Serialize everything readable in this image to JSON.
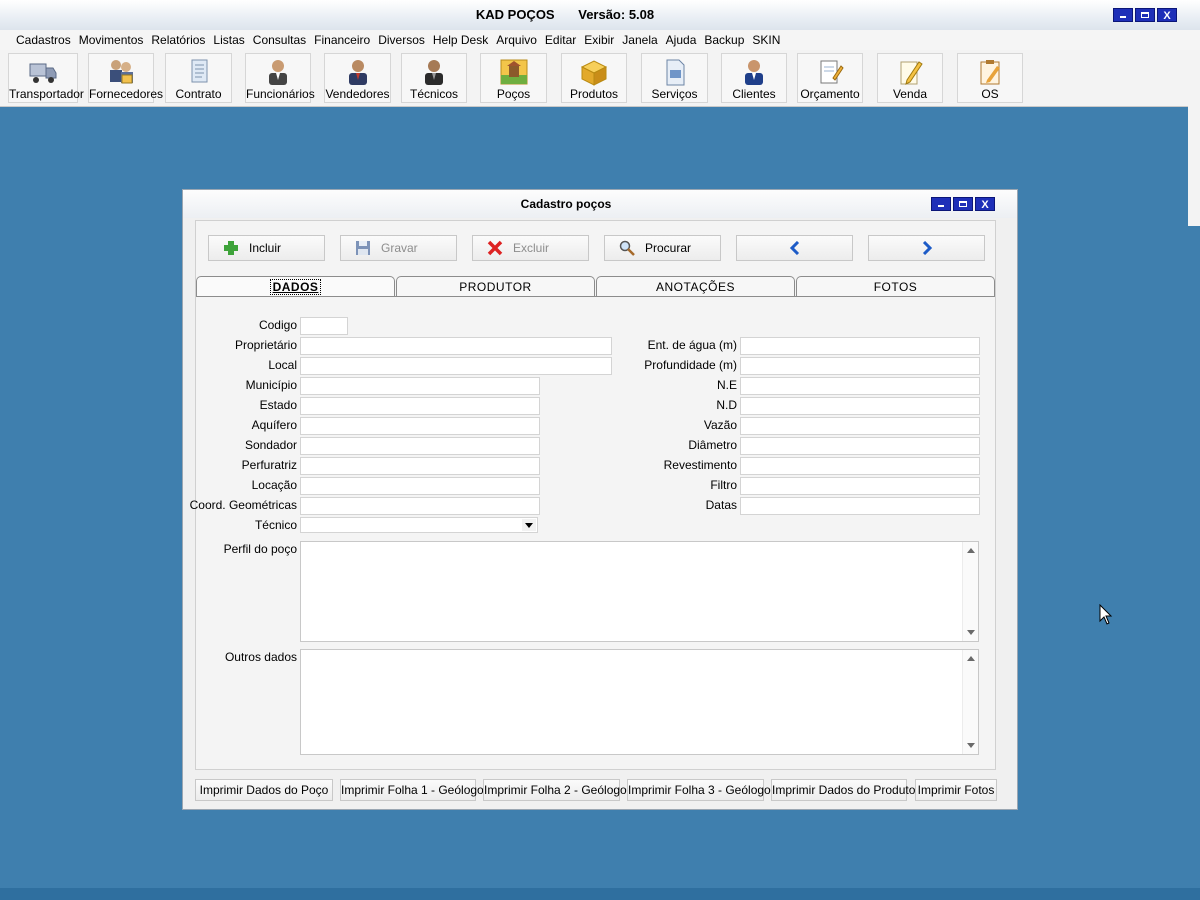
{
  "window": {
    "app_title": "KAD POÇOS",
    "version": "Versão: 5.08"
  },
  "menu": [
    "Cadastros",
    "Movimentos",
    "Relatórios",
    "Listas",
    "Consultas",
    "Financeiro",
    "Diversos",
    "Help Desk",
    "Arquivo",
    "Editar",
    "Exibir",
    "Janela",
    "Ajuda",
    "Backup",
    "SKIN"
  ],
  "toolbar": {
    "transportador": "Transportador",
    "fornecedores": "Fornecedores",
    "contrato": "Contrato",
    "funcionarios": "Funcionários",
    "vendedores": "Vendedores",
    "tecnicos": "Técnicos",
    "pocos": "Poços",
    "produtos": "Produtos",
    "servicos": "Serviços",
    "clientes": "Clientes",
    "orcamento": "Orçamento",
    "venda": "Venda",
    "os": "OS"
  },
  "dialog": {
    "title": "Cadastro poços",
    "actions": {
      "incluir": "Incluir",
      "gravar": "Gravar",
      "excluir": "Excluir",
      "procurar": "Procurar"
    },
    "tabs": {
      "dados": "DADOS",
      "produtor": "PRODUTOR",
      "anotacoes": "ANOTAÇÕES",
      "fotos": "FOTOS"
    },
    "labels": {
      "codigo": "Codigo",
      "proprietario": "Proprietário",
      "local": "Local",
      "municipio": "Município",
      "estado": "Estado",
      "aquifero": "Aquífero",
      "sondador": "Sondador",
      "perfuratriz": "Perfuratriz",
      "locacao": "Locação",
      "coord": "Coord. Geométricas",
      "tecnico": "Técnico",
      "ent_agua": "Ent. de água (m)",
      "profundidade": "Profundidade (m)",
      "ne": "N.E",
      "nd": "N.D",
      "vazao": "Vazão",
      "diametro": "Diâmetro",
      "revestimento": "Revestimento",
      "filtro": "Filtro",
      "datas": "Datas",
      "perfil": "Perfil do poço",
      "outros": "Outros dados"
    },
    "values": {
      "codigo": "",
      "proprietario": "",
      "local": "",
      "municipio": "",
      "estado": "",
      "aquifero": "",
      "sondador": "",
      "perfuratriz": "",
      "locacao": "",
      "coord": "",
      "tecnico": "",
      "ent_agua": "",
      "profundidade": "",
      "ne": "",
      "nd": "",
      "vazao": "",
      "diametro": "",
      "revestimento": "",
      "filtro": "",
      "datas": "",
      "perfil": "",
      "outros": ""
    },
    "print_buttons": {
      "dados_poco": "Imprimir Dados do Poço",
      "folha1": "Imprimir Folha 1 - Geólogo",
      "folha2": "Imprimir Folha 2 - Geólogo",
      "folha3": "Imprimir Folha 3 - Geólogo",
      "dados_produtor": "Imprimir Dados do Produtor",
      "fotos": "Imprimir Fotos"
    }
  }
}
